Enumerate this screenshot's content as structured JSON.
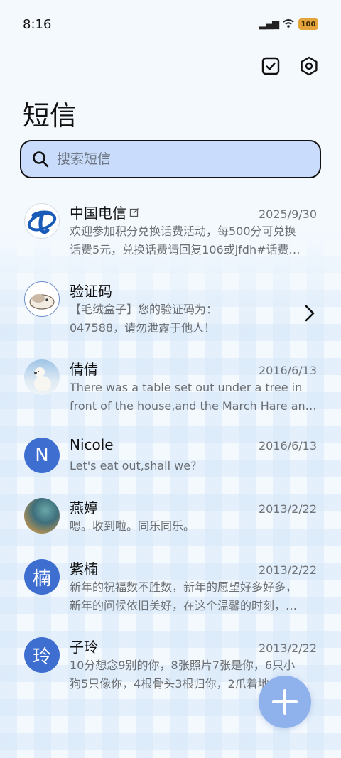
{
  "status_bar": {
    "time": "8:16",
    "battery": "100"
  },
  "header": {
    "title": "短信"
  },
  "search": {
    "placeholder": "搜索短信"
  },
  "conversations": [
    {
      "name": "中国电信",
      "date": "2025/9/30",
      "line1": "欢迎参加积分兑换话费活动，每500分可兑换",
      "line2": "话费5元，兑换话费请回复106或jfdh#话费…"
    },
    {
      "name": "验证码",
      "date": "",
      "line1": "【毛绒盒子】您的验证码为：",
      "line2": "047588，请勿泄露于他人！"
    },
    {
      "name": "倩倩",
      "date": "2016/6/13",
      "line1": "There was a table set out under a tree in",
      "line2": "front of the house,and the March Hare an…"
    },
    {
      "name": "Nicole",
      "date": "2016/6/13",
      "avatar_letter": "N",
      "line1": "Let's eat out,shall we?"
    },
    {
      "name": "燕婷",
      "date": "2013/2/22",
      "line1": "嗯。收到啦。同乐同乐。"
    },
    {
      "name": "紫楠",
      "date": "2013/2/22",
      "avatar_letter": "楠",
      "line1": "新年的祝福数不胜数，新年的愿望好多好多，",
      "line2": "新年的问候依旧美好，在这个温馨的时刻，…"
    },
    {
      "name": "子玲",
      "date": "2013/2/22",
      "avatar_letter": "玲",
      "line1": "10分想念9别的你，8张照片7张是你，6只小",
      "line2": "狗5只像你，4根骨头3根归你，2爪着地1宅…"
    }
  ],
  "colors": {
    "accent": "#3e6fd0",
    "search_bg": "#c9dcfb",
    "fab": "#8fb2ec"
  }
}
